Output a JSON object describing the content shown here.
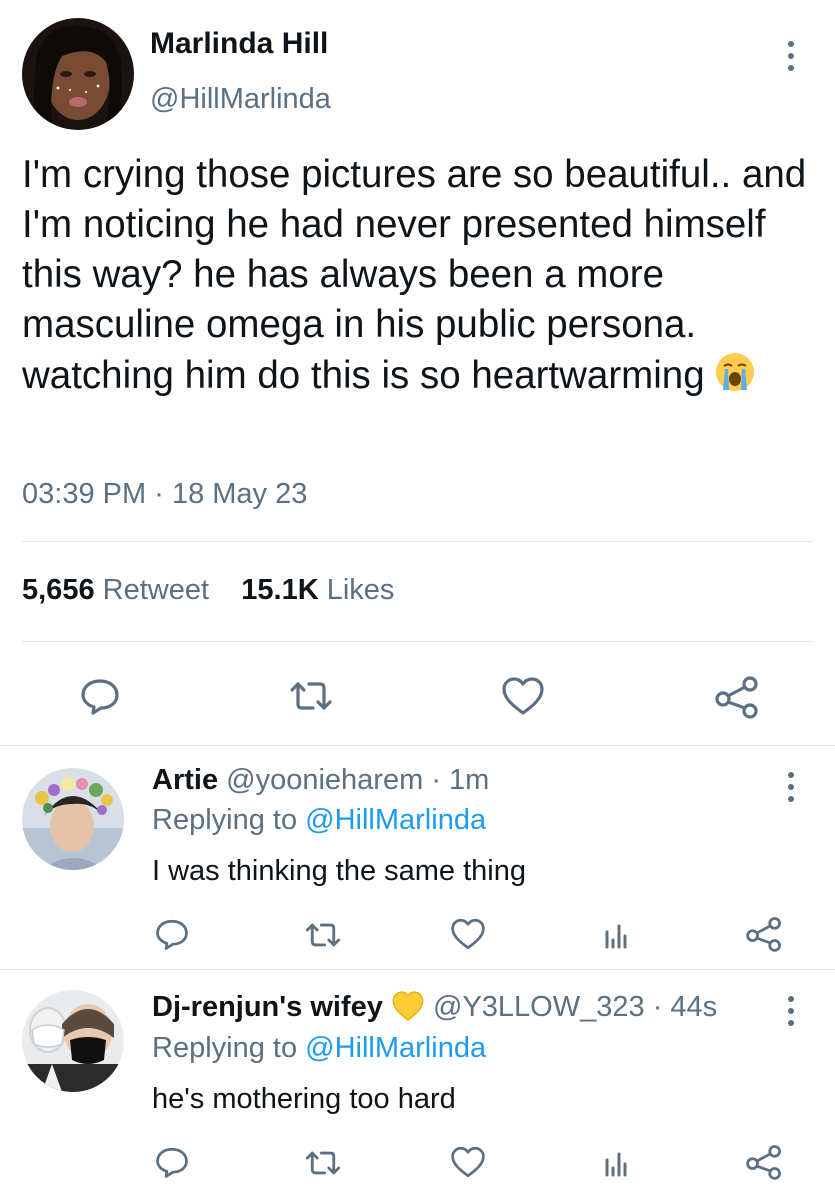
{
  "tweet": {
    "author_name": "Marlinda Hill",
    "author_handle": "@HillMarlinda",
    "text": "I'm crying those pictures are so beautiful.. and I'm noticing he had never presented himself this way? he has always been a more masculine omega in his public persona. watching him do this is so heartwarming",
    "text_emoji": "loudly-crying-face-emoji",
    "time": "03:39 PM",
    "separator": "·",
    "date": "18 May 23",
    "retweets_count": "5,656",
    "retweets_label": "Retweet",
    "likes_count": "15.1K",
    "likes_label": "Likes",
    "actions": [
      "reply-icon",
      "retweet-icon",
      "like-icon",
      "share-icon"
    ]
  },
  "replies": [
    {
      "name": "Artie",
      "handle": "@yoonieharem",
      "separator": "·",
      "time": "1m",
      "replying_prefix": "Replying to",
      "replying_to": "@HillMarlinda",
      "text": "I was thinking the same thing",
      "actions": [
        "reply-icon",
        "retweet-icon",
        "like-icon",
        "analytics-icon",
        "share-icon"
      ]
    },
    {
      "name": "Dj-renjun's wifey",
      "name_emoji": "yellow-heart-emoji",
      "handle": "@Y3LLOW_323",
      "separator": "·",
      "time": "44s",
      "replying_prefix": "Replying to",
      "replying_to": "@HillMarlinda",
      "text": "he's mothering too hard",
      "actions": [
        "reply-icon",
        "retweet-icon",
        "like-icon",
        "analytics-icon",
        "share-icon"
      ]
    }
  ],
  "colors": {
    "accent": "#1d9bf0",
    "secondary_text": "#5b7083",
    "divider": "#e1e8ed"
  }
}
